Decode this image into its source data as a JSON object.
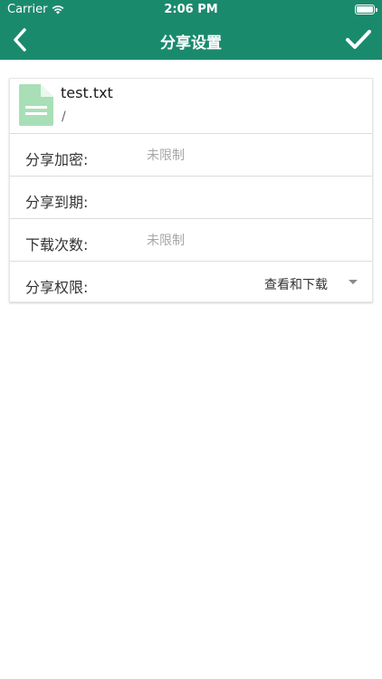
{
  "status_bar": {
    "carrier": "Carrier",
    "time": "2:06 PM",
    "wifi_icon": "wifi-icon",
    "battery_icon": "battery-icon"
  },
  "nav": {
    "title": "分享设置",
    "back_icon": "chevron-left-icon",
    "confirm_icon": "checkmark-icon"
  },
  "file": {
    "name": "test.txt",
    "path": "/",
    "icon": "document-icon"
  },
  "settings": {
    "encryption": {
      "label": "分享加密:",
      "placeholder": "未限制"
    },
    "expiry": {
      "label": "分享到期:",
      "value": ""
    },
    "download_count": {
      "label": "下载次数:",
      "placeholder": "未限制"
    },
    "permission": {
      "label": "分享权限:",
      "value": "查看和下载",
      "caret_icon": "caret-down-icon"
    }
  },
  "colors": {
    "header": "#1a8a6d",
    "file_icon": "#a8dfb6"
  }
}
